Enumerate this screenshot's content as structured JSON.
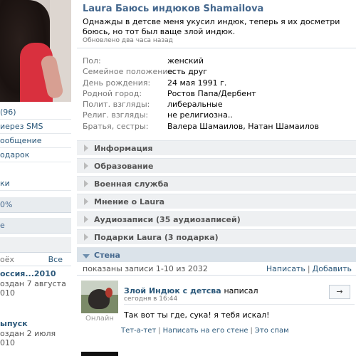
{
  "profile": {
    "name": "Laura Баюсь индюков Shamailova",
    "status": "Однажды в детсве меня укусил индюк, теперь я их досметри боюсь, но тот был ваще злой индюк.",
    "updated": "Обновлено два часа назад"
  },
  "info": [
    {
      "label": "Пол:",
      "value": "женский"
    },
    {
      "label": "Семейное положение:",
      "value": "есть друг"
    },
    {
      "label": "День рождения:",
      "value": "24 мая 1991 г."
    },
    {
      "label": "Родной город:",
      "value": "Ростов Папа/Дербент"
    },
    {
      "label": "Полит. взгляды:",
      "value": "либеральные"
    },
    {
      "label": "Религ. взгляды:",
      "value": "не религиозна.."
    },
    {
      "label": "Братья, сестры:",
      "value": "Валера Шамаилов, Натан Шамаилов"
    }
  ],
  "sections": [
    {
      "label": "Информация",
      "open": false
    },
    {
      "label": "Образование",
      "open": false
    },
    {
      "label": "Военная служба",
      "open": false
    },
    {
      "label": "Мнение о Laura",
      "open": false
    },
    {
      "label": "Аудиозаписи (35 аудиозаписей)",
      "open": false
    },
    {
      "label": "Подарки Laura (3 подарка)",
      "open": false
    },
    {
      "label": "Стена",
      "open": true
    }
  ],
  "wall": {
    "count": "показаны записи 1-10 из 2032",
    "write": "Написать",
    "add": "Добавить",
    "sep": "|"
  },
  "post": {
    "author": "Злой Индюк с детсва",
    "wrote": "написал",
    "date": "сегодня в 16:44",
    "online": "Онлайн",
    "text": "Так вот ты где, сука! я тебя искал!",
    "reply": "→",
    "links": [
      "Тет-а-тет",
      "Написать на его стене",
      "Это спам"
    ]
  },
  "left": {
    "menu": [
      "(96)",
      "иерез SMS",
      "ообщение",
      "одарок"
    ],
    "item2": "ки",
    "percent": "0%",
    "item3": "е",
    "blog_head_left": "оёх",
    "blog_head_right": "Все",
    "blog1_title": "оссия...2010",
    "blog1_date": "оздан 7 августа",
    "blog1_year": "010",
    "blog2_title": "ыпуск",
    "blog2_date": "оздан 2 июля",
    "blog2_year": "010"
  }
}
